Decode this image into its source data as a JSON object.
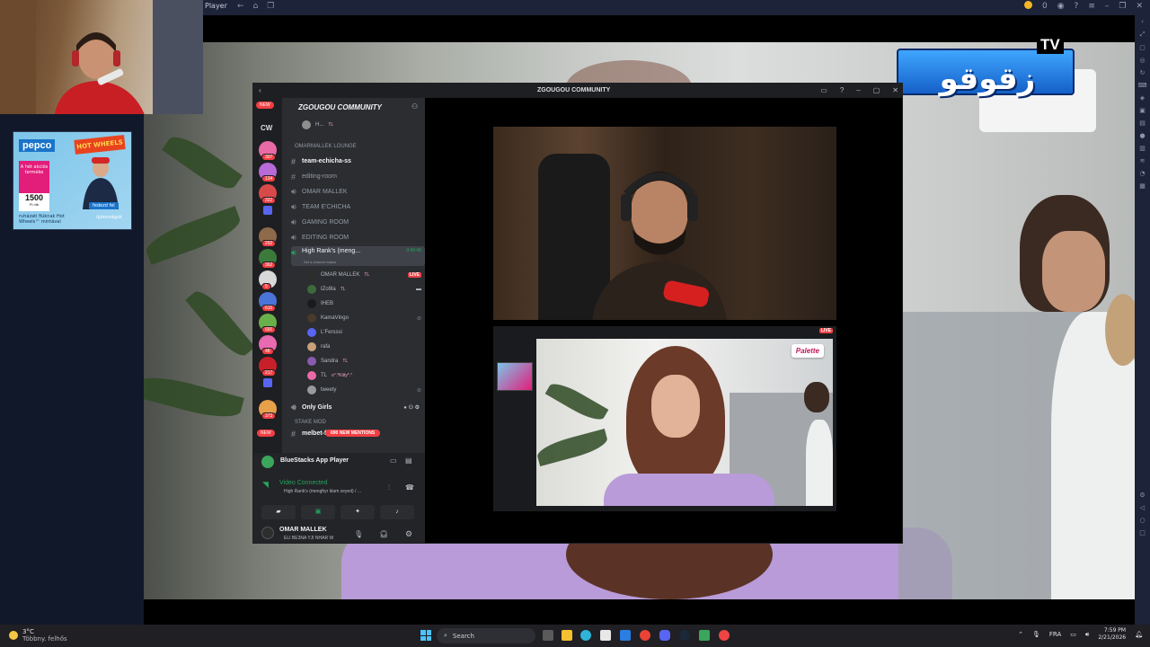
{
  "bluestacks": {
    "title": "Player",
    "coins": "0",
    "sidebar_icons": [
      "chevron-left-icon",
      "expand-icon",
      "window-icon",
      "camera-icon",
      "rotate-icon",
      "keyboard-icon",
      "gamepad-icon",
      "folder-icon",
      "screenshot-icon",
      "record-icon",
      "macro-icon",
      "shake-icon",
      "eco-icon",
      "settings-icon",
      "back-icon",
      "home-icon",
      "recents-icon"
    ]
  },
  "ad": {
    "brand": "pepco",
    "hot_wheels": "HOT WHEELS",
    "box_text": "A hét akciós terméke",
    "price": "1500",
    "price_unit": "Ft /db",
    "small_text": "ruházati fiúknak Hot Wheels™ mintával",
    "btn": "fedezd fel",
    "btn2": "újdonságok"
  },
  "logo": {
    "text": "زقوقو",
    "tv": "TV"
  },
  "discord": {
    "window_title": "ZGOUGOU COMMUNITY",
    "server_name": "ZGOUGOU COMMUNITY",
    "new_badge": "NEW",
    "cw": "CW",
    "guild_badges": [
      "307",
      "134",
      "322",
      "292",
      "362",
      "5",
      "615",
      "691",
      "48",
      "217",
      "373"
    ],
    "top_member": {
      "name": "H...",
      "tag": "TL"
    },
    "category1": "OMARMALLEK LOUNGE",
    "channels": [
      {
        "name": "team-echicha-ss",
        "type": "text",
        "bold": true
      },
      {
        "name": "editing-room",
        "type": "text",
        "bold": false
      },
      {
        "name": "OMAR MALLEK",
        "type": "voice",
        "bold": false
      },
      {
        "name": "TEAM E'CHICHA",
        "type": "voice",
        "bold": false
      },
      {
        "name": "GAMING ROOM",
        "type": "voice",
        "bold": false
      },
      {
        "name": "EDITING ROOM",
        "type": "voice",
        "bold": false
      }
    ],
    "active_channel": {
      "name": "High Rank's (meng...",
      "timer": "0:40:46",
      "status": "Set a channel status"
    },
    "members": [
      {
        "name": "OMAR MALLEK",
        "tag": "TL",
        "live": "LIVE"
      },
      {
        "name": "IZo9la",
        "tag": "TL",
        "live": ""
      },
      {
        "name": "IHEB",
        "tag": "",
        "live": ""
      },
      {
        "name": "KamaVingo",
        "tag": "",
        "live": ""
      },
      {
        "name": "L'Fersssi",
        "tag": "",
        "live": ""
      },
      {
        "name": "rafa",
        "tag": "",
        "live": ""
      },
      {
        "name": "Sandra",
        "tag": "TL",
        "live": ""
      },
      {
        "name": "TL",
        "tag": "o°.*Kitty*.°",
        "live": ""
      },
      {
        "name": "tweety",
        "tag": "",
        "live": ""
      }
    ],
    "only_girls": "Only Girls",
    "category2": "Stake Mod",
    "last_channel": "melbet-finos",
    "new_mentions": "690 NEW MENTIONS",
    "bottom_new": "NEW",
    "app_name": "BlueStacks App Player",
    "video_connected": "Video Connected",
    "vc_sub": "High Rank's (mengħyr klam zeyed) / ...",
    "user_name": "OMAR MALLEK",
    "user_status": "ELI BE3NA YJI NHAR W",
    "live_tag": "LIVE",
    "palette": "Palette"
  },
  "taskbar": {
    "weather_temp": "3°C",
    "weather_desc": "Többny. felhős",
    "search": "Search",
    "lang": "FRA",
    "time": "7:59 PM",
    "date": "2/21/2026"
  },
  "colors": {
    "discord_bg": "#313338",
    "live_red": "#ed4245",
    "connected_green": "#23a55a",
    "logo_blue": "#1f7be0"
  }
}
